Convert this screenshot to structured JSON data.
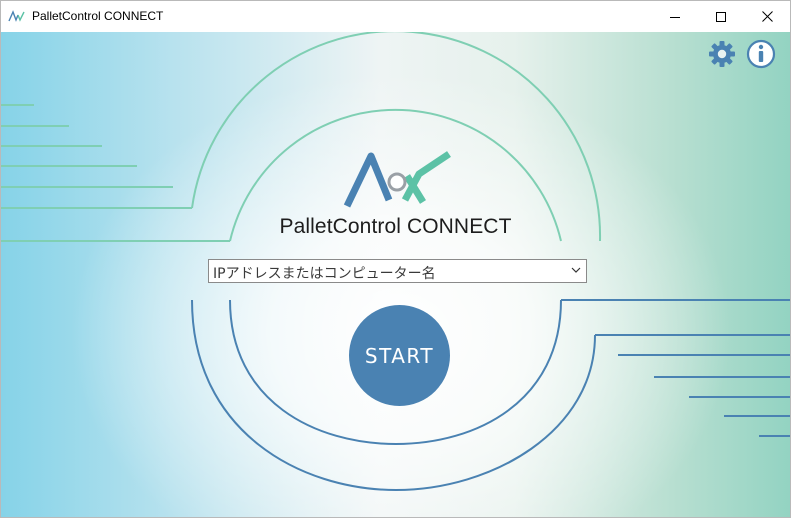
{
  "window": {
    "title": "PalletControl CONNECT",
    "controls": [
      "minimize",
      "maximize",
      "close"
    ]
  },
  "toolbar": {
    "settings_icon": "gear-icon",
    "info_icon": "info-icon"
  },
  "logo": {
    "text": "PalletControl CONNECT"
  },
  "host_select": {
    "placeholder": "IPアドレスまたはコンピューター名",
    "icon": "chevron-down-icon"
  },
  "start_button": {
    "label": "START"
  },
  "colors": {
    "accent_blue": "#4a82b2",
    "accent_teal": "#5cc2a6",
    "line_teal": "#7fcfb3",
    "line_blue": "#4a82b2"
  }
}
